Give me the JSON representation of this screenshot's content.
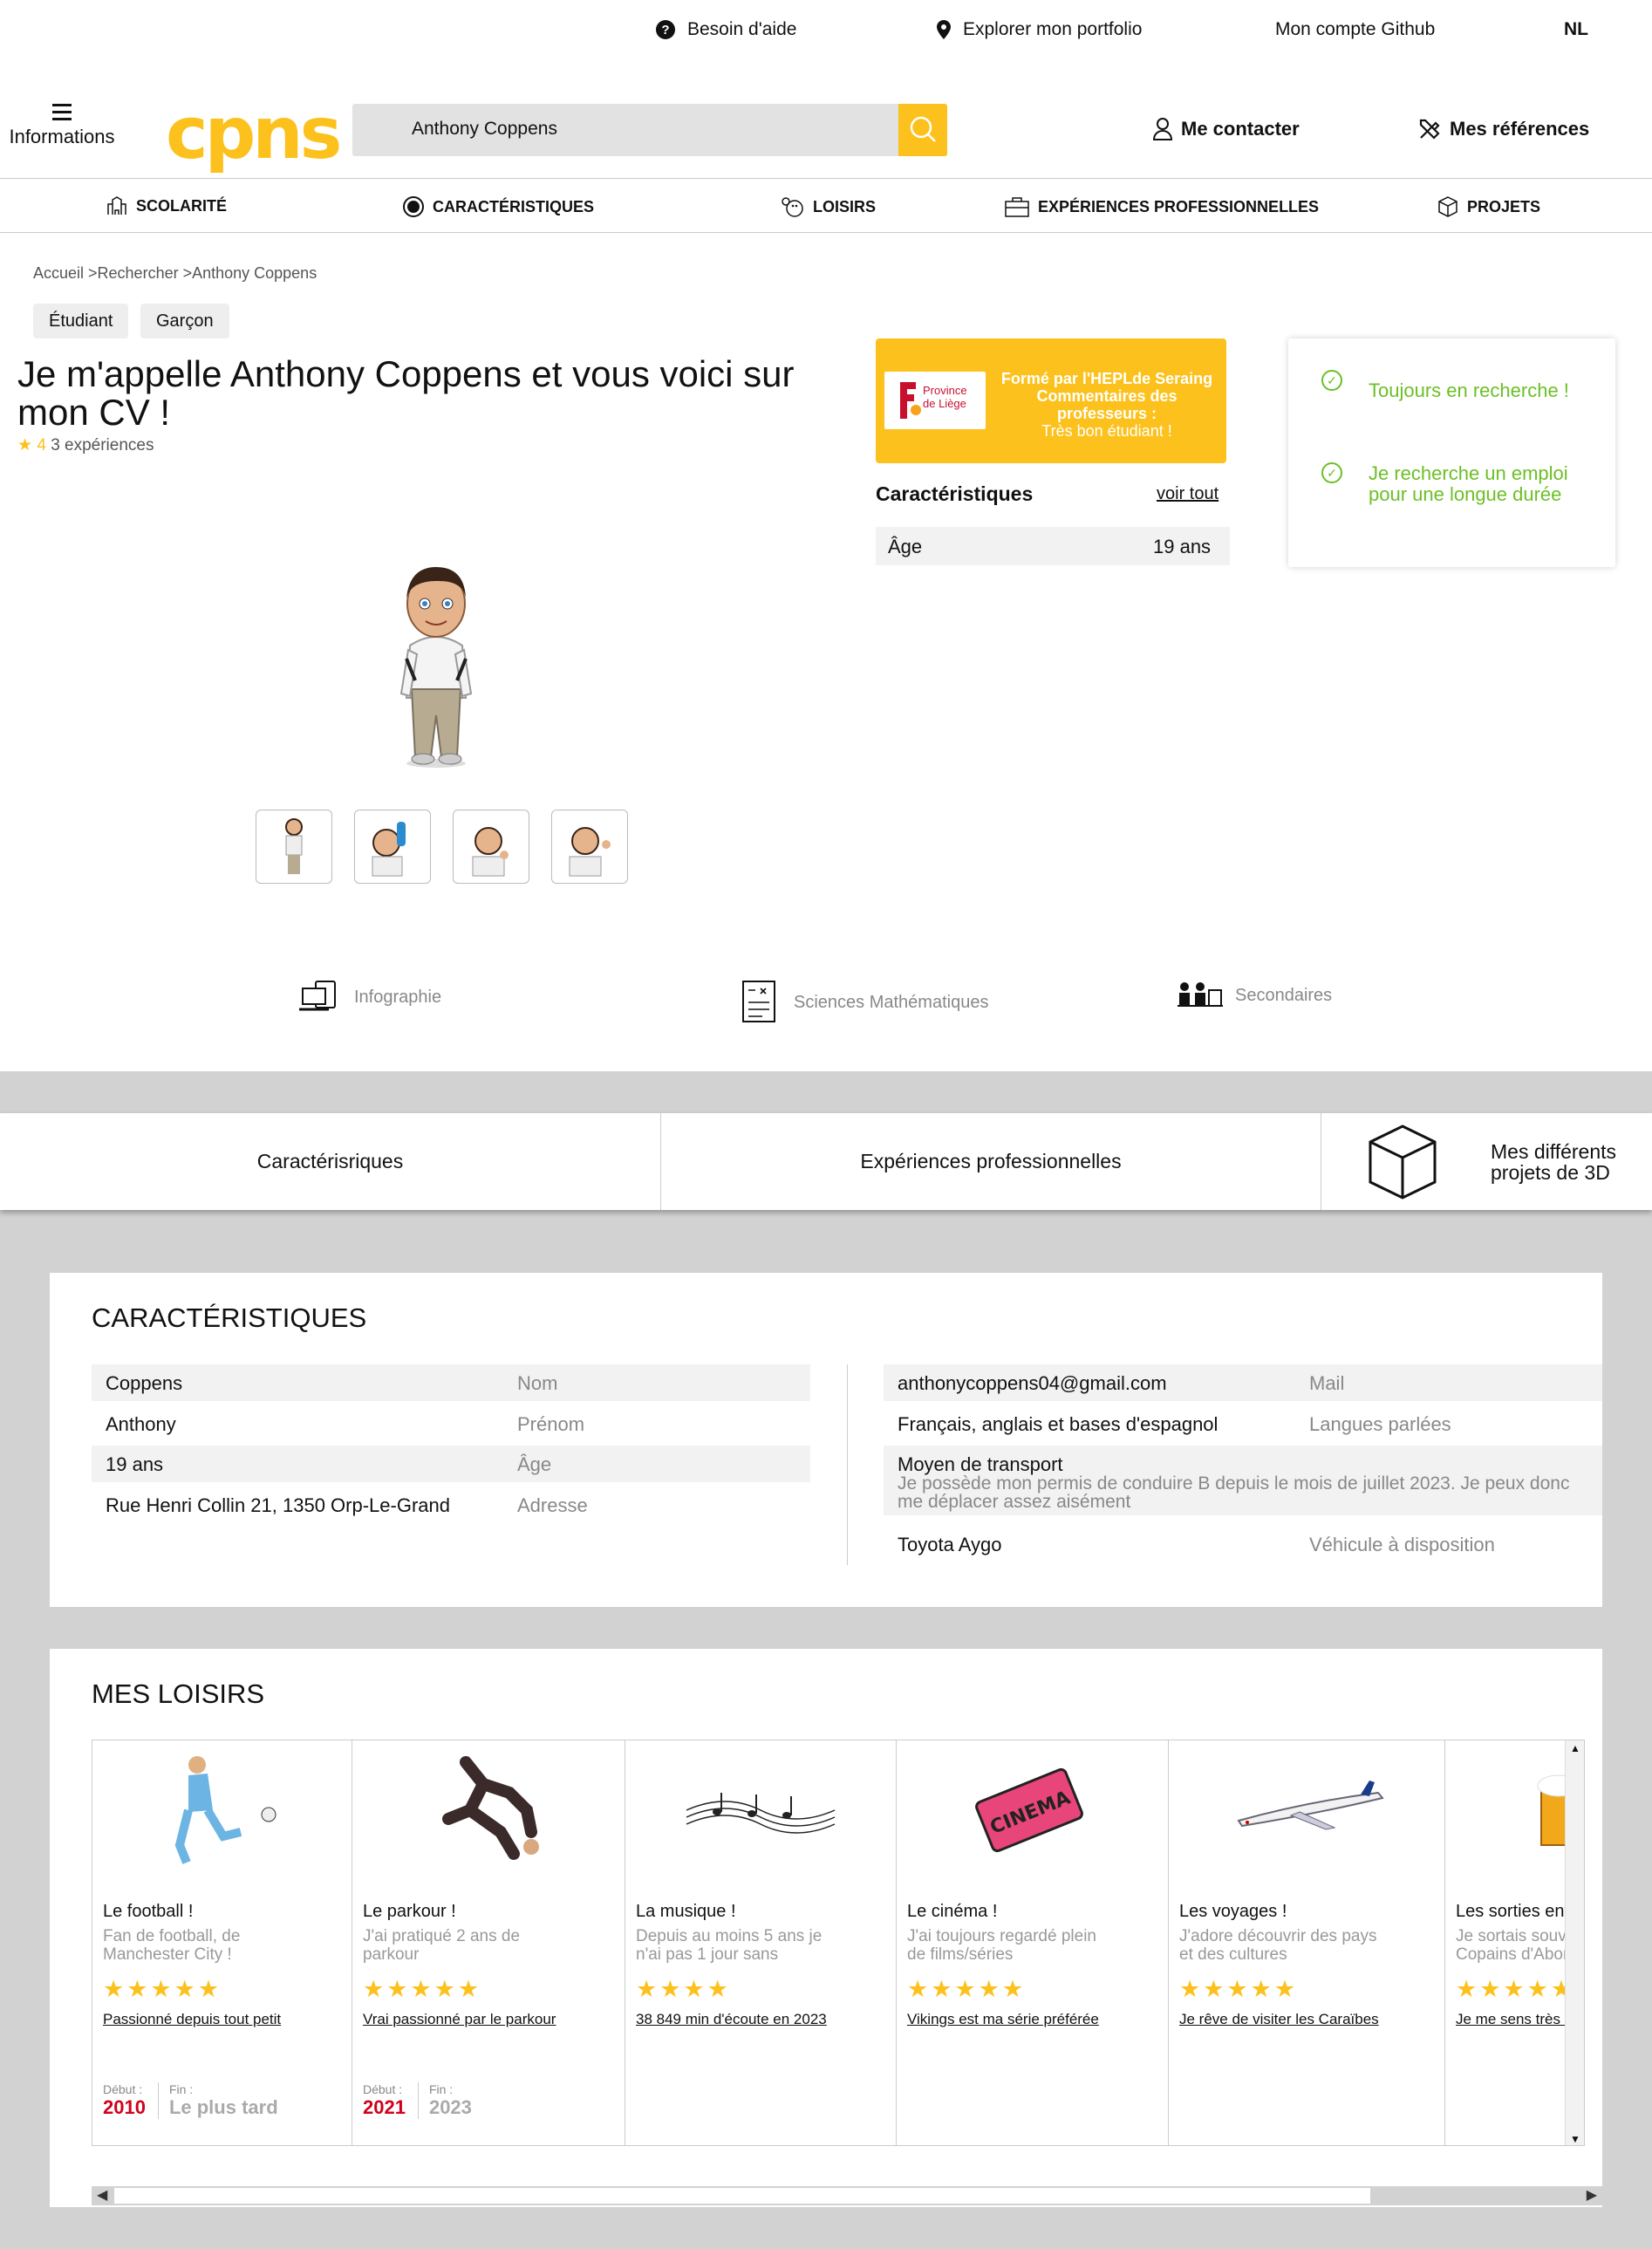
{
  "topbar": {
    "help": "Besoin d'aide",
    "portfolio": "Explorer mon portfolio",
    "github": "Mon compte Github",
    "lang": "NL"
  },
  "header": {
    "menu_label": "Informations",
    "logo": "cpns",
    "search_value": "Anthony Coppens",
    "contact": "Me contacter",
    "references": "Mes références"
  },
  "nav": [
    "SCOLARITÉ",
    "CARACTÉRISTIQUES",
    "LOISIRS",
    "EXPÉRIENCES PROFESSIONNELLES",
    "PROJETS"
  ],
  "breadcrumb": "Accueil >Rechercher >Anthony Coppens",
  "tags": [
    "Étudiant",
    "Garçon"
  ],
  "title": "Je m'appelle Anthony Coppens et vous voici sur mon CV !",
  "rating": {
    "star": "★",
    "score": "4",
    "experiences": "3 expériences"
  },
  "categories": [
    "Infographie",
    "Sciences Mathématiques",
    "Secondaires"
  ],
  "promo": {
    "logo_line1": "Province",
    "logo_line2": "de Liège",
    "line1": "Formé par l'HEPLde Seraing",
    "line2": "Commentaires des professeurs :",
    "line3": "Très bon étudiant !"
  },
  "caracteristiques_box": {
    "title": "Caractéristiques",
    "link": "voir tout",
    "age_label": "Âge",
    "age_value": "19 ans"
  },
  "goals": [
    "Toujours en recherche !",
    "Je recherche un emploi pour une longue durée"
  ],
  "tabs": [
    "Caractérisriques",
    "Expériences professionnelles",
    "Mes différents projets de 3D"
  ],
  "carac": {
    "title": "CARACTÉRISTIQUES",
    "left": [
      {
        "value": "Coppens",
        "label": "Nom"
      },
      {
        "value": "Anthony",
        "label": "Prénom"
      },
      {
        "value": "19 ans",
        "label": "Âge"
      },
      {
        "value": "Rue Henri Collin 21, 1350 Orp-Le-Grand",
        "label": "Adresse"
      }
    ],
    "right": [
      {
        "value": "anthonycoppens04@gmail.com",
        "label": "Mail"
      },
      {
        "value": "Français, anglais et bases d'espagnol",
        "label": "Langues parlées"
      },
      {
        "value": "Moyen de transport",
        "detail": "Je possède mon permis de conduire B depuis le mois de juillet 2023. Je peux donc me déplacer assez aisément"
      },
      {
        "value": "Toyota Aygo",
        "label": "Véhicule à disposition"
      }
    ]
  },
  "loisirs": {
    "title": "MES LOISIRS",
    "debut_label": "Début :",
    "fin_label": "Fin :",
    "items": [
      {
        "title": "Le football !",
        "desc": "Fan de football, de Manchester City !",
        "stars": 5,
        "link": "Passionné depuis tout petit",
        "start": "2010",
        "end": "Le plus tard"
      },
      {
        "title": "Le parkour !",
        "desc": "J'ai pratiqué 2 ans de parkour",
        "stars": 5,
        "link": "Vrai passionné par le parkour",
        "start": "2021",
        "end": "2023"
      },
      {
        "title": "La musique !",
        "desc": "Depuis au moins 5 ans je n'ai pas 1 jour sans",
        "stars": 4,
        "link": "38 849 min d'écoute en 2023"
      },
      {
        "title": "Le cinéma !",
        "desc": "J'ai toujours regardé plein de films/séries",
        "stars": 5,
        "link": "Vikings est ma série préférée",
        "img_text": "CINEMA"
      },
      {
        "title": "Les voyages !",
        "desc": "J'adore découvrir des pays et des cultures",
        "stars": 5,
        "link": "Je rêve de visiter les Caraïbes"
      },
      {
        "title": "Les sorties entr",
        "desc": "Je sortais souv Copains d'Abor",
        "stars": 5,
        "link": "Je me sens très l"
      }
    ]
  },
  "colors": {
    "accent": "#fcc11c",
    "green": "#6cbf26",
    "red": "#d0021b",
    "background_gray": "#d3d2d3"
  }
}
